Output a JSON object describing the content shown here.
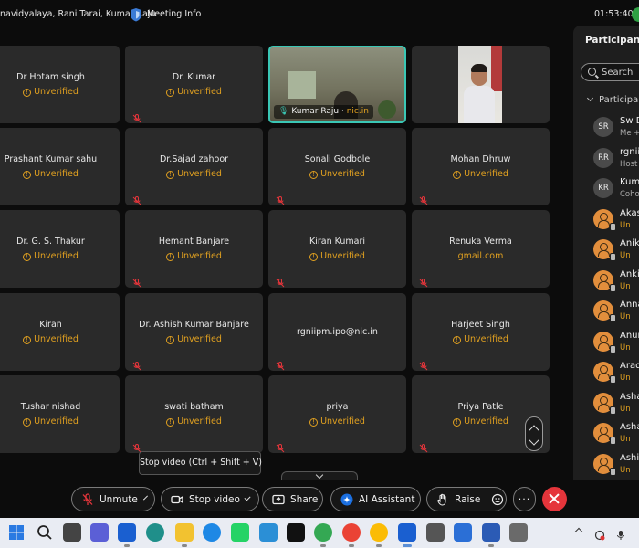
{
  "header": {
    "title": "navidyalaya, Rani Tarai, Kumar Raju",
    "meeting_info": "Meeting Info",
    "clock": "01:53:40"
  },
  "tiles": [
    {
      "name": "Dr Hotam singh",
      "status": "Unverified",
      "muted": true
    },
    {
      "name": "Dr. Kumar",
      "status": "Unverified",
      "muted": true
    },
    {
      "name": "Kumar Raju",
      "domain": "nic.in",
      "video": "active-speaker"
    },
    {
      "name": "",
      "video": "camera"
    },
    {
      "name": "Prashant Kumar sahu",
      "status": "Unverified",
      "muted": true
    },
    {
      "name": "Dr.Sajad zahoor",
      "status": "Unverified",
      "muted": true
    },
    {
      "name": "Sonali Godbole",
      "status": "Unverified",
      "muted": true
    },
    {
      "name": "Mohan Dhruw",
      "status": "Unverified",
      "muted": true
    },
    {
      "name": "Dr. G. S. Thakur",
      "status": "Unverified",
      "muted": true
    },
    {
      "name": "Hemant Banjare",
      "status": "Unverified",
      "muted": true
    },
    {
      "name": "Kiran Kumari",
      "status": "Unverified",
      "muted": true
    },
    {
      "name": "Renuka Verma",
      "status": "gmail.com",
      "muted": true
    },
    {
      "name": "Kiran",
      "status": "Unverified",
      "muted": true
    },
    {
      "name": "Dr. Ashish Kumar Banjare",
      "status": "Unverified",
      "muted": true
    },
    {
      "name": "rgniipm.ipo@nic.in",
      "status": "",
      "muted": true
    },
    {
      "name": "Harjeet Singh",
      "status": "Unverified",
      "muted": true
    },
    {
      "name": "Tushar nishad",
      "status": "Unverified",
      "muted": true
    },
    {
      "name": "swati batham",
      "status": "Unverified",
      "muted": true
    },
    {
      "name": "priya",
      "status": "Unverified",
      "muted": true
    },
    {
      "name": "Priya Patle",
      "status": "Unverified",
      "muted": true
    }
  ],
  "tooltip": "Stop video (Ctrl + Shift + V)",
  "controls": {
    "unmute": "Unmute",
    "stop_video": "Stop video",
    "share": "Share",
    "ai_assistant": "AI Assistant",
    "raise": "Raise"
  },
  "panel": {
    "title": "Participants",
    "search_placeholder": "Search",
    "section": "Participants",
    "participants": [
      {
        "initials": "SR",
        "name": "Sw D",
        "sub": "Me +",
        "guest": false
      },
      {
        "initials": "RR",
        "name": "rgnii",
        "sub": "Host",
        "guest": false
      },
      {
        "initials": "KR",
        "name": "Kum",
        "sub": "Coho",
        "guest": false
      },
      {
        "initials": "",
        "name": "Akas",
        "sub": "Un",
        "guest": true
      },
      {
        "initials": "",
        "name": "Anik",
        "sub": "Un",
        "guest": true
      },
      {
        "initials": "",
        "name": "Anki",
        "sub": "Un",
        "guest": true
      },
      {
        "initials": "",
        "name": "Anna",
        "sub": "Un",
        "guest": true
      },
      {
        "initials": "",
        "name": "Anur",
        "sub": "Un",
        "guest": true
      },
      {
        "initials": "",
        "name": "Arad",
        "sub": "Un",
        "guest": true
      },
      {
        "initials": "",
        "name": "Asha",
        "sub": "Un",
        "guest": true
      },
      {
        "initials": "",
        "name": "Asha",
        "sub": "Un",
        "guest": true
      },
      {
        "initials": "",
        "name": "Ashi",
        "sub": "Un",
        "guest": true
      }
    ]
  },
  "taskbar": {
    "icons": [
      "windows-start",
      "search",
      "task-view",
      "chat",
      "webex",
      "edge",
      "file-explorer",
      "media-player",
      "whatsapp",
      "news",
      "netflix",
      "chrome",
      "chrome-profile",
      "chrome-alt",
      "webex-active",
      "camera",
      "photos",
      "word",
      "settings"
    ],
    "colors": {
      "background": "#e9ecf3",
      "accent": "#5b8fd6"
    }
  },
  "colors": {
    "background": "#0c0c0c",
    "tile": "#2a2a2a",
    "unverified": "#e0a020",
    "active_border": "#3ac7b5",
    "leave": "#e5353b"
  }
}
